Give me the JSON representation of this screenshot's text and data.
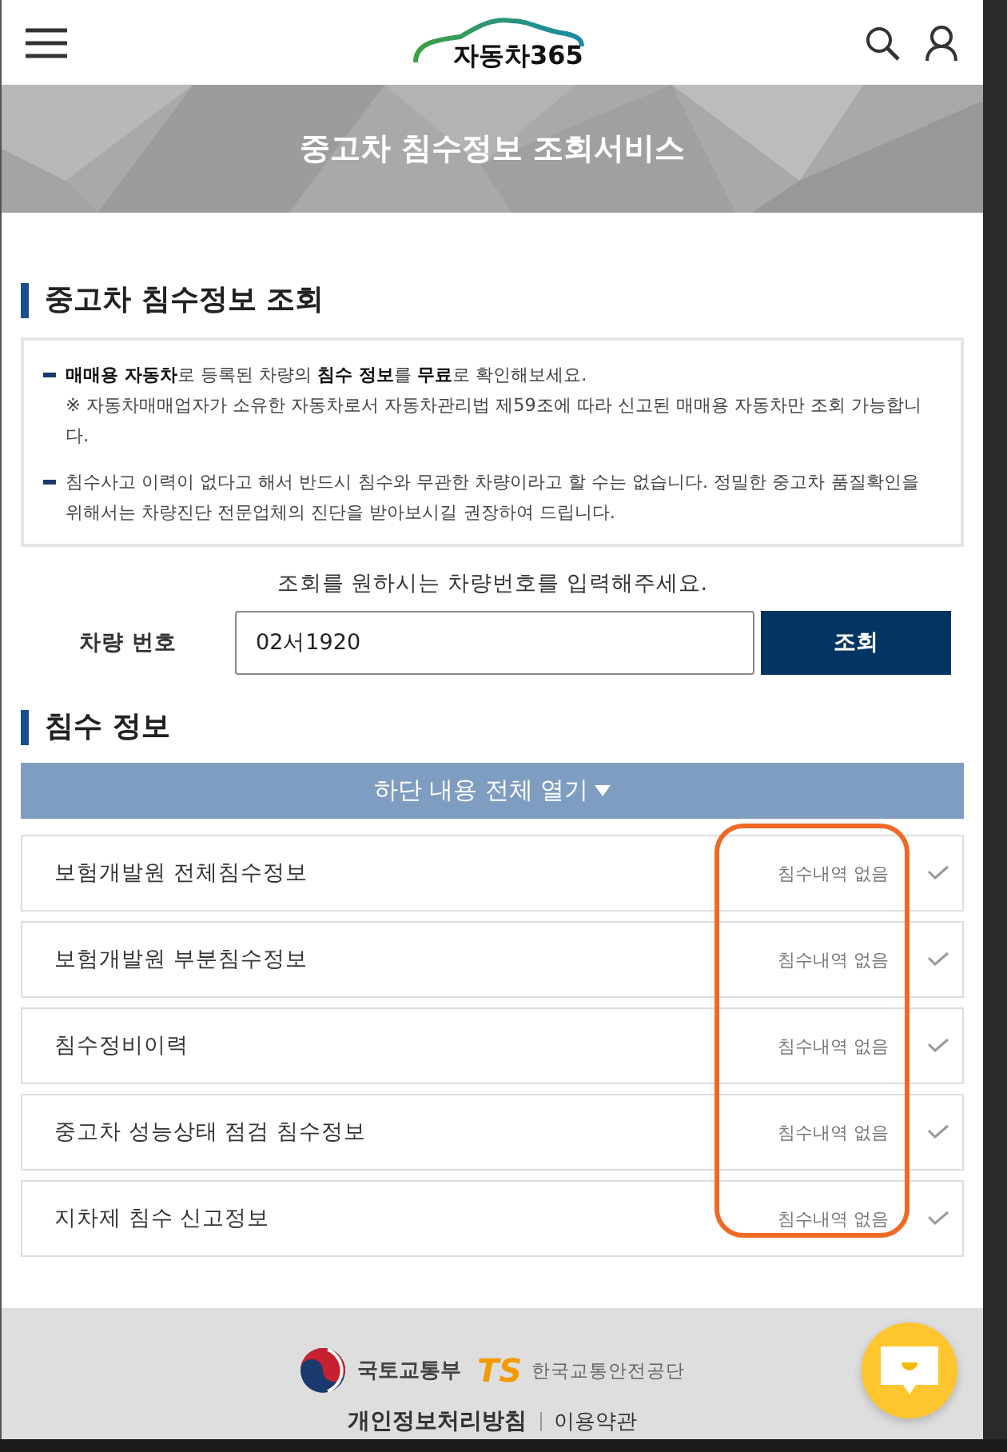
{
  "header": {
    "logo_text": "자동차365"
  },
  "banner": {
    "title": "중고차 침수정보 조회서비스"
  },
  "lookup_section": {
    "title": "중고차 침수정보 조회",
    "notices": [
      {
        "text": "**매매용 자동차**로 등록된 차량의 **침수 정보**를 **무료**로 확인해보세요.",
        "note": "※ 자동차매매업자가 소유한 자동차로서 자동차관리법 제59조에 따라 신고된 매매용 자동차만 조회 가능합니다."
      },
      {
        "text": "침수사고 이력이 없다고 해서 반드시 침수와 무관한 차량이라고 할 수는 없습니다. 정밀한 중고차 품질확인을 위해서는 차량진단 전문업체의 진단을 받아보시길 권장하여 드립니다."
      }
    ],
    "prompt": "조회를 원하시는 차량번호를 입력해주세요.",
    "field_label": "차량 번호",
    "field_value": "02서1920",
    "button": "조회"
  },
  "info_section": {
    "title": "침수 정보",
    "expand_all": "하단 내용 전체 열기",
    "items": [
      {
        "label": "보험개발원 전체침수정보",
        "status": "침수내역 없음",
        "expanded": false
      },
      {
        "label": "보험개발원 부분침수정보",
        "status": "침수내역 없음",
        "expanded": false
      },
      {
        "label": "침수정비이력",
        "status": "침수내역 없음",
        "expanded": false
      },
      {
        "label": "중고차 성능상태 점검 침수정보",
        "status": "침수내역 없음",
        "expanded": false
      },
      {
        "label": "지차제 침수 신고정보",
        "status": "침수내역 없음",
        "expanded": false
      }
    ]
  },
  "footer": {
    "ministry": "국토교통부",
    "agency_mark": "TS",
    "agency": "한국교통안전공단",
    "links": [
      "개인정보처리방침",
      "이용약관"
    ]
  }
}
